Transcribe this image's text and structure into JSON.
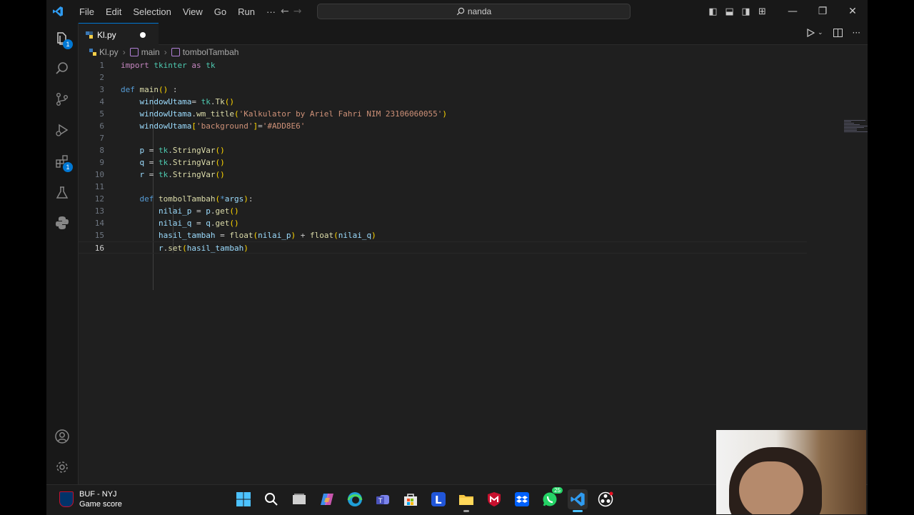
{
  "titlebar": {
    "menu": [
      "File",
      "Edit",
      "Selection",
      "View",
      "Go",
      "Run",
      "···"
    ],
    "search_text": "nanda"
  },
  "activity": {
    "explorer_badge": "1",
    "extensions_badge": "1"
  },
  "tab": {
    "label": "Kl.py"
  },
  "breadcrumb": {
    "file": "Kl.py",
    "scope1": "main",
    "scope2": "tombolTambah"
  },
  "editor": {
    "current_line": 16,
    "lines": [
      "import tkinter as tk",
      "",
      "def main() :",
      "    windowUtama= tk.Tk()",
      "    windowUtama.wm_title('Kalkulator by Ariel Fahri NIM 23106060055')",
      "    windowUtama['background']='#ADD8E6'",
      "",
      "    p = tk.StringVar()",
      "    q = tk.StringVar()",
      "    r = tk.StringVar()",
      "",
      "    def tombolTambah(*args):",
      "        nilai_p = p.get()",
      "        nilai_q = q.get()",
      "        hasil_tambah = float(nilai_p) + float(nilai_q)",
      "        r.set(hasil_tambah)"
    ]
  },
  "taskbar": {
    "widget_line1": "BUF - NYJ",
    "widget_line2": "Game score",
    "whatsapp_badge": "25"
  },
  "colors": {
    "accent": "#0078d4",
    "editor_bg": "#1f1f1f",
    "chrome_bg": "#181818"
  }
}
